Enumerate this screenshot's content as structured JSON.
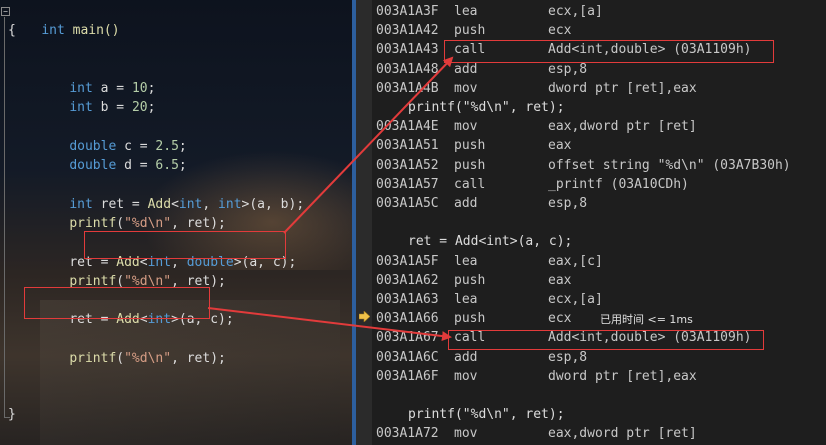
{
  "source_code": {
    "main_signature": "int main()",
    "open_brace": "{",
    "close_brace": "}",
    "lines": {
      "int_a": {
        "kw": "int",
        "rest": " a = ",
        "num": "10",
        "end": ";"
      },
      "int_b": {
        "kw": "int",
        "rest": " b = ",
        "num": "20",
        "end": ";"
      },
      "dbl_c": {
        "kw": "double",
        "rest": " c = ",
        "num": "2.5",
        "end": ";"
      },
      "dbl_d": {
        "kw": "double",
        "rest": " d = ",
        "num": "6.5",
        "end": ";"
      },
      "ret_decl": {
        "kw": "int",
        "mid1": " ret = ",
        "fn": "Add",
        "tpl_open": "<",
        "tpl_kw1": "int",
        "tpl_sep": ", ",
        "tpl_kw2": "int",
        "tpl_close": ">",
        "args": "(a, b);"
      },
      "printf1": {
        "fn": "printf",
        "open": "(",
        "str": "\"%d\\n\"",
        "args": ", ret);"
      },
      "ret_assign_double": {
        "lead": "ret = ",
        "fn": "Add",
        "tpl_open": "<",
        "tpl_kw1": "int",
        "tpl_sep": ", ",
        "tpl_kw2": "double",
        "tpl_close": ">",
        "args": "(a, c);"
      },
      "printf2": {
        "fn": "printf",
        "open": "(",
        "str": "\"%d\\n\"",
        "args": ", ret);"
      },
      "ret_assign_int": {
        "lead": "ret = ",
        "fn": "Add",
        "tpl_open": "<",
        "tpl_kw1": "int",
        "tpl_close": ">",
        "args": "(a, c);"
      },
      "printf3": {
        "fn": "printf",
        "open": "(",
        "str": "\"%d\\n\"",
        "args": ", ret);"
      }
    }
  },
  "disassembly": [
    {
      "addr": "003A1A3F",
      "op": "lea",
      "arg": "ecx,[a]"
    },
    {
      "addr": "003A1A42",
      "op": "push",
      "arg": "ecx"
    },
    {
      "addr": "003A1A43",
      "op": "call",
      "arg": "Add<int,double> (03A1109h)"
    },
    {
      "addr": "003A1A48",
      "op": "add",
      "arg": "esp,8"
    },
    {
      "addr": "003A1A4B",
      "op": "mov",
      "arg": "dword ptr [ret],eax"
    },
    {
      "src": "printf(\"%d\\n\", ret);"
    },
    {
      "addr": "003A1A4E",
      "op": "mov",
      "arg": "eax,dword ptr [ret]"
    },
    {
      "addr": "003A1A51",
      "op": "push",
      "arg": "eax"
    },
    {
      "addr": "003A1A52",
      "op": "push",
      "arg": "offset string \"%d\\n\" (03A7B30h)"
    },
    {
      "addr": "003A1A57",
      "op": "call",
      "arg": "_printf (03A10CDh)"
    },
    {
      "addr": "003A1A5C",
      "op": "add",
      "arg": "esp,8"
    },
    {
      "blank": ""
    },
    {
      "src": "ret = Add<int>(a, c);"
    },
    {
      "addr": "003A1A5F",
      "op": "lea",
      "arg": "eax,[c]"
    },
    {
      "addr": "003A1A62",
      "op": "push",
      "arg": "eax"
    },
    {
      "addr": "003A1A63",
      "op": "lea",
      "arg": "ecx,[a]"
    },
    {
      "addr": "003A1A66",
      "op": "push",
      "arg": "ecx",
      "note": "已用时间 <= 1ms"
    },
    {
      "addr": "003A1A67",
      "op": "call",
      "arg": "Add<int,double> (03A1109h)"
    },
    {
      "addr": "003A1A6C",
      "op": "add",
      "arg": "esp,8"
    },
    {
      "addr": "003A1A6F",
      "op": "mov",
      "arg": "dword ptr [ret],eax"
    },
    {
      "blank": ""
    },
    {
      "src": "printf(\"%d\\n\", ret);"
    },
    {
      "addr": "003A1A72",
      "op": "mov",
      "arg": "eax,dword ptr [ret]"
    }
  ],
  "colors": {
    "keyword": "#569cd6",
    "function": "#dcdcaa",
    "number": "#b5cea8",
    "string": "#d69d85",
    "highlight_box": "#e23b3b",
    "arrow": "#e23b3b",
    "current_line_arrow": "#f0c24a",
    "separator": "#2d5f9e"
  },
  "icons": {
    "collapse": "collapse-box-icon",
    "current_instruction": "instruction-pointer-arrow-icon"
  }
}
